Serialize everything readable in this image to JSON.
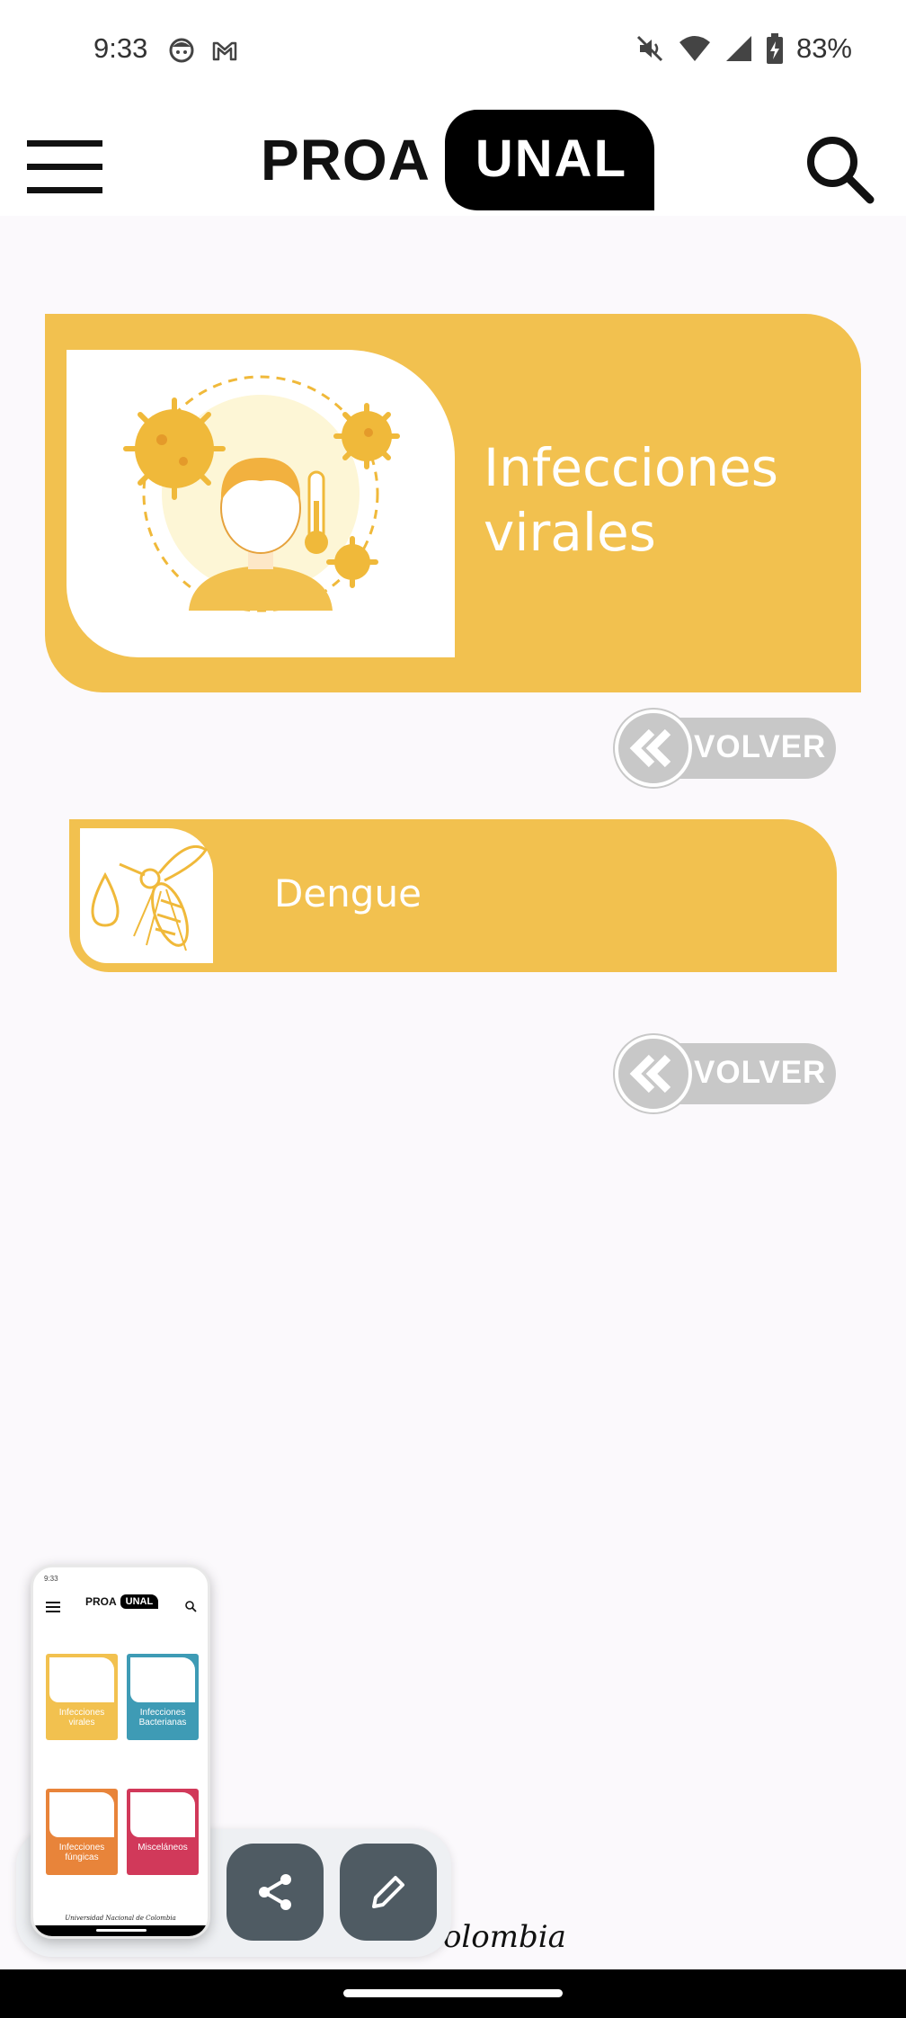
{
  "status_bar": {
    "time": "9:33",
    "left_icons": [
      "face-icon",
      "gmail-icon"
    ],
    "right_icons": [
      "mute-icon",
      "wifi-icon",
      "signal-icon",
      "battery-charging-icon"
    ],
    "battery": "83%"
  },
  "header": {
    "menu_icon": "hamburger-icon",
    "logo_left": "PROA",
    "logo_right": "UNAL",
    "search_icon": "search-icon"
  },
  "hero": {
    "title_line1": "Infecciones",
    "title_line2": "virales",
    "illustration": "sick-child-virus-illustration",
    "color": "#f2c14f"
  },
  "volver_label": "VOLVER",
  "items": [
    {
      "label": "Dengue",
      "icon": "mosquito-drop-icon"
    }
  ],
  "footer_text": "cional de Colombia",
  "screenshot_preview": {
    "logo_left": "PROA",
    "logo_right": "UNAL",
    "status_time": "9:33",
    "tiles": [
      {
        "label": "Infecciones virales",
        "color": "#f2c14f"
      },
      {
        "label": "Infecciones Bacterianas",
        "color": "#3e9bb5"
      },
      {
        "label": "Infecciones fúngicas",
        "color": "#e8843a"
      },
      {
        "label": "Misceláneos",
        "color": "#d1395a"
      }
    ],
    "footer": "Universidad Nacional de Colombia"
  },
  "actions": {
    "share_icon": "share-icon",
    "edit_icon": "edit-pencil-icon"
  },
  "colors": {
    "accent": "#f2c14f",
    "volver_gray": "#c8c8c8",
    "fab": "#4f5b63"
  }
}
